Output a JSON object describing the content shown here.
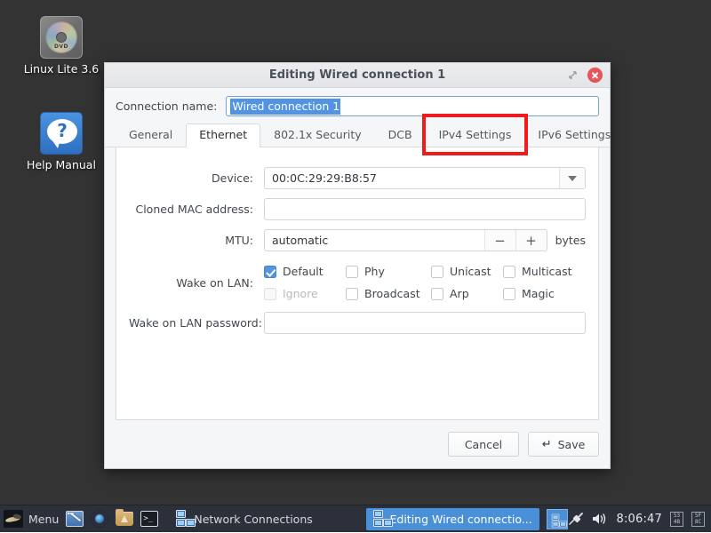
{
  "desktop": {
    "icons": [
      {
        "label": "Linux Lite 3.6",
        "icon": "dvd-disc-icon"
      },
      {
        "label": "Help Manual",
        "icon": "help-question-icon"
      }
    ]
  },
  "dialog": {
    "title": "Editing Wired connection 1",
    "window_buttons": {
      "restore": "restore-icon",
      "close": "close-icon"
    },
    "connection_name": {
      "label": "Connection name:",
      "value": "Wired connection 1",
      "selected": true
    },
    "tabs": [
      {
        "label": "General",
        "active": false,
        "highlighted": false
      },
      {
        "label": "Ethernet",
        "active": true,
        "highlighted": false
      },
      {
        "label": "802.1x Security",
        "active": false,
        "highlighted": false
      },
      {
        "label": "DCB",
        "active": false,
        "highlighted": false
      },
      {
        "label": "IPv4 Settings",
        "active": false,
        "highlighted": true
      },
      {
        "label": "IPv6 Settings",
        "active": false,
        "highlighted": false
      }
    ],
    "highlight_color": "#ee1c1c",
    "ethernet": {
      "device": {
        "label": "Device:",
        "value": "00:0C:29:29:B8:57"
      },
      "cloned_mac": {
        "label": "Cloned MAC address:",
        "value": "",
        "placeholder": ""
      },
      "mtu": {
        "label": "MTU:",
        "value": "automatic",
        "minus": "−",
        "plus": "+",
        "unit": "bytes"
      },
      "wake_on_lan": {
        "label": "Wake on LAN:",
        "options": [
          {
            "label": "Default",
            "checked": true,
            "disabled": false
          },
          {
            "label": "Phy",
            "checked": false,
            "disabled": false
          },
          {
            "label": "Unicast",
            "checked": false,
            "disabled": false
          },
          {
            "label": "Multicast",
            "checked": false,
            "disabled": false
          },
          {
            "label": "Ignore",
            "checked": false,
            "disabled": true
          },
          {
            "label": "Broadcast",
            "checked": false,
            "disabled": false
          },
          {
            "label": "Arp",
            "checked": false,
            "disabled": false
          },
          {
            "label": "Magic",
            "checked": false,
            "disabled": false
          }
        ]
      },
      "wol_password": {
        "label": "Wake on LAN password:",
        "value": ""
      }
    },
    "buttons": {
      "cancel": "Cancel",
      "save": "Save",
      "save_glyph": "↵"
    }
  },
  "taskbar": {
    "menu": {
      "label": "Menu",
      "icon": "linux-lite-bird-icon"
    },
    "launchers": [
      {
        "icon": "show-desktop-icon",
        "name": "show-desktop"
      },
      {
        "icon": "firefox-icon",
        "name": "firefox"
      },
      {
        "icon": "folder-icon",
        "name": "file-manager"
      },
      {
        "icon": "terminal-icon",
        "name": "terminal",
        "glyph": ">_"
      }
    ],
    "windows": [
      {
        "label": "Network Connections",
        "active": false,
        "icon": "network-connections-icon"
      },
      {
        "label": "Editing Wired connectio...",
        "active": true,
        "icon": "network-connections-icon"
      }
    ],
    "pager": {
      "icon": "workspace-switcher-icon"
    },
    "tray": [
      {
        "name": "network-plug-icon"
      },
      {
        "name": "volume-icon"
      }
    ],
    "clock": "8:06:47",
    "missing_glyphs": [
      {
        "top": "53",
        "bottom": "48"
      },
      {
        "top": "5F",
        "bottom": "8C"
      }
    ]
  }
}
